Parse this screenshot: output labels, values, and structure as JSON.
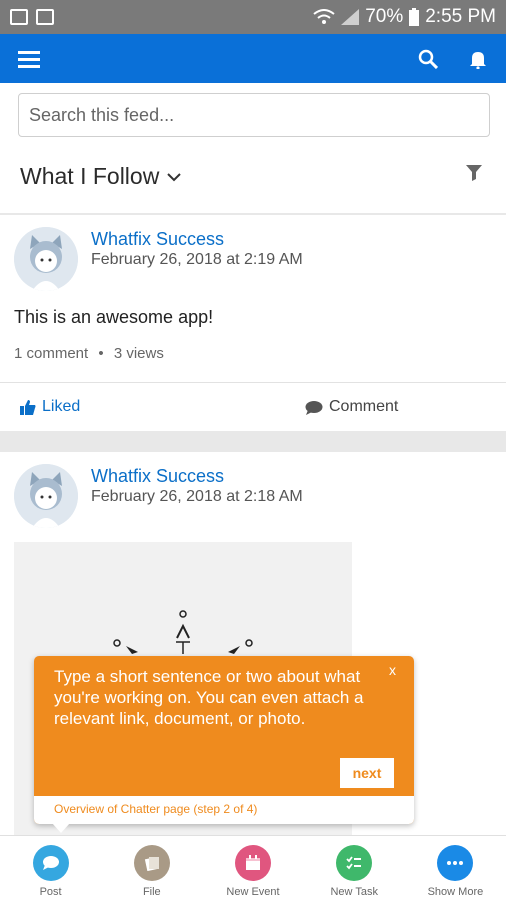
{
  "status_bar": {
    "battery": "70%",
    "time": "2:55 PM"
  },
  "search": {
    "placeholder": "Search this feed..."
  },
  "feed_filter": {
    "label": "What I Follow"
  },
  "posts": [
    {
      "author": "Whatfix Success",
      "date": "February 26, 2018 at 2:19 AM",
      "text": "This is an awesome app!",
      "comments": "1 comment",
      "separator": "•",
      "views": "3 views",
      "like_label": "Liked",
      "comment_label": "Comment"
    },
    {
      "author": "Whatfix Success",
      "date": "February 26, 2018 at 2:18 AM"
    }
  ],
  "tooltip": {
    "text": "Type a short sentence or two about what you're working on. You can even attach a relevant link, document, or photo.",
    "close": "x",
    "next_label": "next",
    "footer": "Overview of Chatter page (step 2 of 4)"
  },
  "bottom_nav": [
    {
      "label": "Post",
      "color": "#35a7e0"
    },
    {
      "label": "File",
      "color": "#a99a86"
    },
    {
      "label": "New Event",
      "color": "#e0567f"
    },
    {
      "label": "New Task",
      "color": "#3fb86b"
    },
    {
      "label": "Show More",
      "color": "#1a8ae6"
    }
  ],
  "colors": {
    "app_bar": "#0a70d8",
    "status_bar": "#7a7a7a",
    "tooltip": "#ef8b1e",
    "link": "#0b6fc8"
  }
}
